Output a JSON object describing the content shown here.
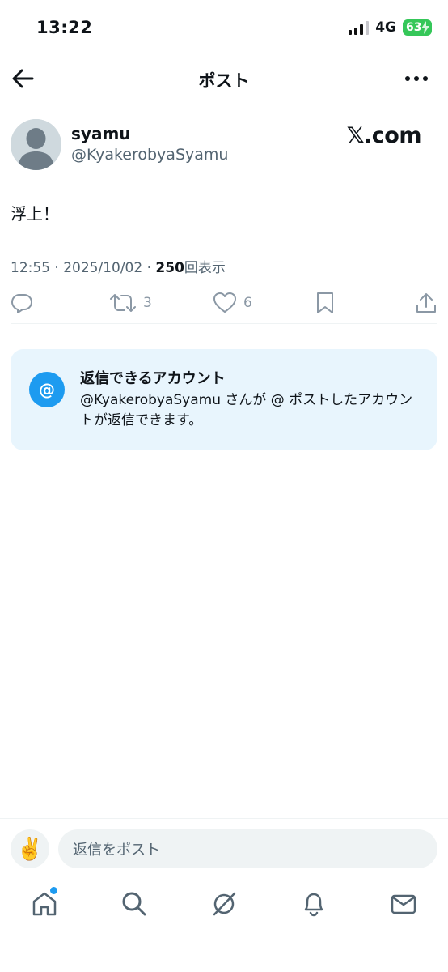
{
  "status_bar": {
    "time": "13:22",
    "network": "4G",
    "battery": "63"
  },
  "header": {
    "title": "ポスト"
  },
  "post": {
    "display_name": "syamu",
    "handle": "@KyakerobyaSyamu",
    "source_logo": "𝕏.com",
    "text": "浮上！",
    "timestamp": "12:55 · 2025/10/02 · ",
    "views_count": "250",
    "views_label": "回表示",
    "actions": {
      "replies": "",
      "reposts": "3",
      "likes": "6"
    }
  },
  "reply_info": {
    "title": "返信できるアカウント",
    "body": "@KyakerobyaSyamu さんが @ ポストしたアカウントが返信できます。",
    "icon_text": "@"
  },
  "reply_bar": {
    "avatar_emoji": "✌️",
    "placeholder": "返信をポスト"
  },
  "icons": [
    "back-arrow-icon",
    "more-icon",
    "reply-icon",
    "repost-icon",
    "like-icon",
    "bookmark-icon",
    "share-icon",
    "home-icon",
    "search-icon",
    "grok-icon",
    "notifications-icon",
    "messages-icon"
  ],
  "colors": {
    "accent": "#1d9bf0",
    "card_bg": "#e8f5fd",
    "muted": "#536471",
    "icon_gray": "#8b98a5"
  }
}
